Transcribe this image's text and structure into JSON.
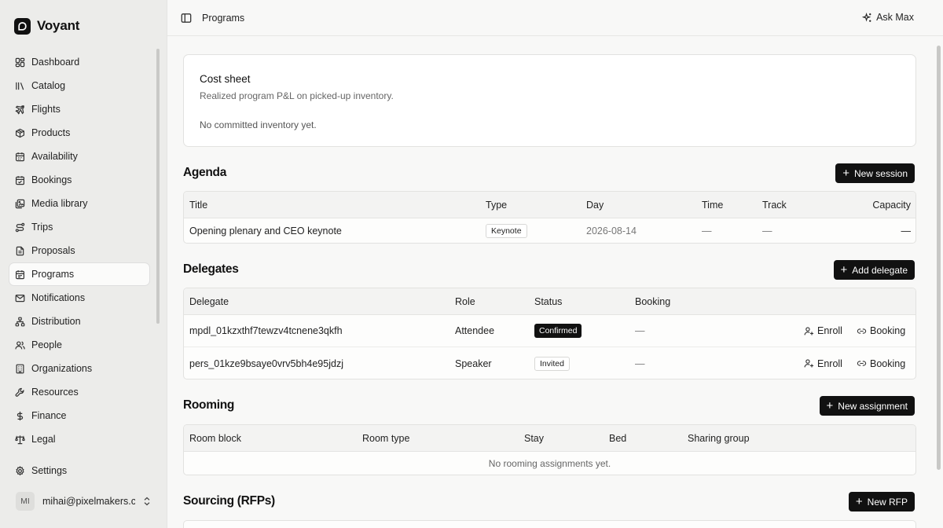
{
  "brand": {
    "name": "Voyant"
  },
  "sidebar": {
    "items": [
      {
        "label": "Dashboard",
        "icon": "grid-icon"
      },
      {
        "label": "Catalog",
        "icon": "library-icon"
      },
      {
        "label": "Flights",
        "icon": "plane-icon"
      },
      {
        "label": "Products",
        "icon": "package-icon"
      },
      {
        "label": "Availability",
        "icon": "calendar-icon"
      },
      {
        "label": "Bookings",
        "icon": "calendar-check-icon"
      },
      {
        "label": "Media library",
        "icon": "images-icon"
      },
      {
        "label": "Trips",
        "icon": "route-icon"
      },
      {
        "label": "Proposals",
        "icon": "file-icon"
      },
      {
        "label": "Programs",
        "icon": "calendar-range-icon",
        "active": true
      },
      {
        "label": "Notifications",
        "icon": "mail-icon"
      },
      {
        "label": "Distribution",
        "icon": "network-icon"
      },
      {
        "label": "People",
        "icon": "users-icon"
      },
      {
        "label": "Organizations",
        "icon": "building-icon"
      },
      {
        "label": "Resources",
        "icon": "wrench-icon"
      },
      {
        "label": "Finance",
        "icon": "dollar-icon"
      },
      {
        "label": "Legal",
        "icon": "scale-icon"
      }
    ],
    "settings": {
      "label": "Settings",
      "icon": "gear-icon"
    },
    "user": {
      "initials": "MI",
      "email": "mihai@pixelmakers.c..."
    }
  },
  "topbar": {
    "title": "Programs",
    "ask_label": "Ask Max"
  },
  "cost_sheet": {
    "title": "Cost sheet",
    "subtitle": "Realized program P&L on picked-up inventory.",
    "empty": "No committed inventory yet."
  },
  "agenda": {
    "title": "Agenda",
    "button": "New session",
    "columns": [
      "Title",
      "Type",
      "Day",
      "Time",
      "Track",
      "Capacity"
    ],
    "rows": [
      {
        "title": "Opening plenary and CEO keynote",
        "type": "Keynote",
        "day": "2026-08-14",
        "time": "—",
        "track": "—",
        "capacity": "—"
      }
    ]
  },
  "delegates": {
    "title": "Delegates",
    "button": "Add delegate",
    "columns": [
      "Delegate",
      "Role",
      "Status",
      "Booking"
    ],
    "enroll_label": "Enroll",
    "booking_label": "Booking",
    "rows": [
      {
        "id": "mpdl_01kzxthf7tewzv4tcnene3qkfh",
        "role": "Attendee",
        "status": "Confirmed",
        "booking": "—"
      },
      {
        "id": "pers_01kze9bsaye0vrv5bh4e95jdzj",
        "role": "Speaker",
        "status": "Invited",
        "booking": "—"
      }
    ]
  },
  "rooming": {
    "title": "Rooming",
    "button": "New assignment",
    "columns": [
      "Room block",
      "Room type",
      "Stay",
      "Bed",
      "Sharing group"
    ],
    "empty": "No rooming assignments yet."
  },
  "sourcing": {
    "title": "Sourcing (RFPs)",
    "button": "New RFP"
  }
}
